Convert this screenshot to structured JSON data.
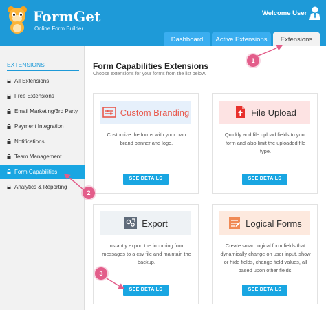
{
  "header": {
    "brand": "FormGet",
    "tagline": "Online Form Builder",
    "welcome": "Welcome User",
    "tabs": [
      {
        "label": "Dashboard"
      },
      {
        "label": "Active Extensions"
      },
      {
        "label": "Extensions"
      }
    ]
  },
  "sidebar": {
    "heading": "EXTENSIONS",
    "items": [
      {
        "label": "All Extensions"
      },
      {
        "label": "Free Extensions"
      },
      {
        "label": "Email Marketing/3rd Party"
      },
      {
        "label": "Payment Integration"
      },
      {
        "label": "Notifications"
      },
      {
        "label": "Team Management"
      },
      {
        "label": "Form Capabilities"
      },
      {
        "label": "Analytics & Reporting"
      }
    ],
    "active_index": 6
  },
  "main": {
    "title": "Form Capabilities Extensions",
    "subtitle": "Choose extensions for your forms from the list below.",
    "cards": [
      {
        "name": "Custom Branding",
        "description": "Customize the forms with your own brand banner and logo.",
        "button": "SEE DETAILS",
        "icon": "branding-icon"
      },
      {
        "name": "File Upload",
        "description": "Quickly add file upload fields to your form and also limit the uploaded file type.",
        "button": "SEE DETAILS",
        "icon": "file-upload-icon"
      },
      {
        "name": "Export",
        "description": "Instantly export the incoming form messages to a csv file and maintain the backup.",
        "button": "SEE DETAILS",
        "icon": "export-icon"
      },
      {
        "name": "Logical Forms",
        "description": "Create smart logical form fields that dynamically change on user input. show or hide fields, change field values, all based upon other fields.",
        "button": "SEE DETAILS",
        "icon": "logical-forms-icon"
      }
    ]
  },
  "callouts": [
    "1",
    "2",
    "3"
  ],
  "colors": {
    "header_blue": "#1e9ad8",
    "active_blue": "#19a6e2",
    "callout_pink": "#e35d8a"
  }
}
